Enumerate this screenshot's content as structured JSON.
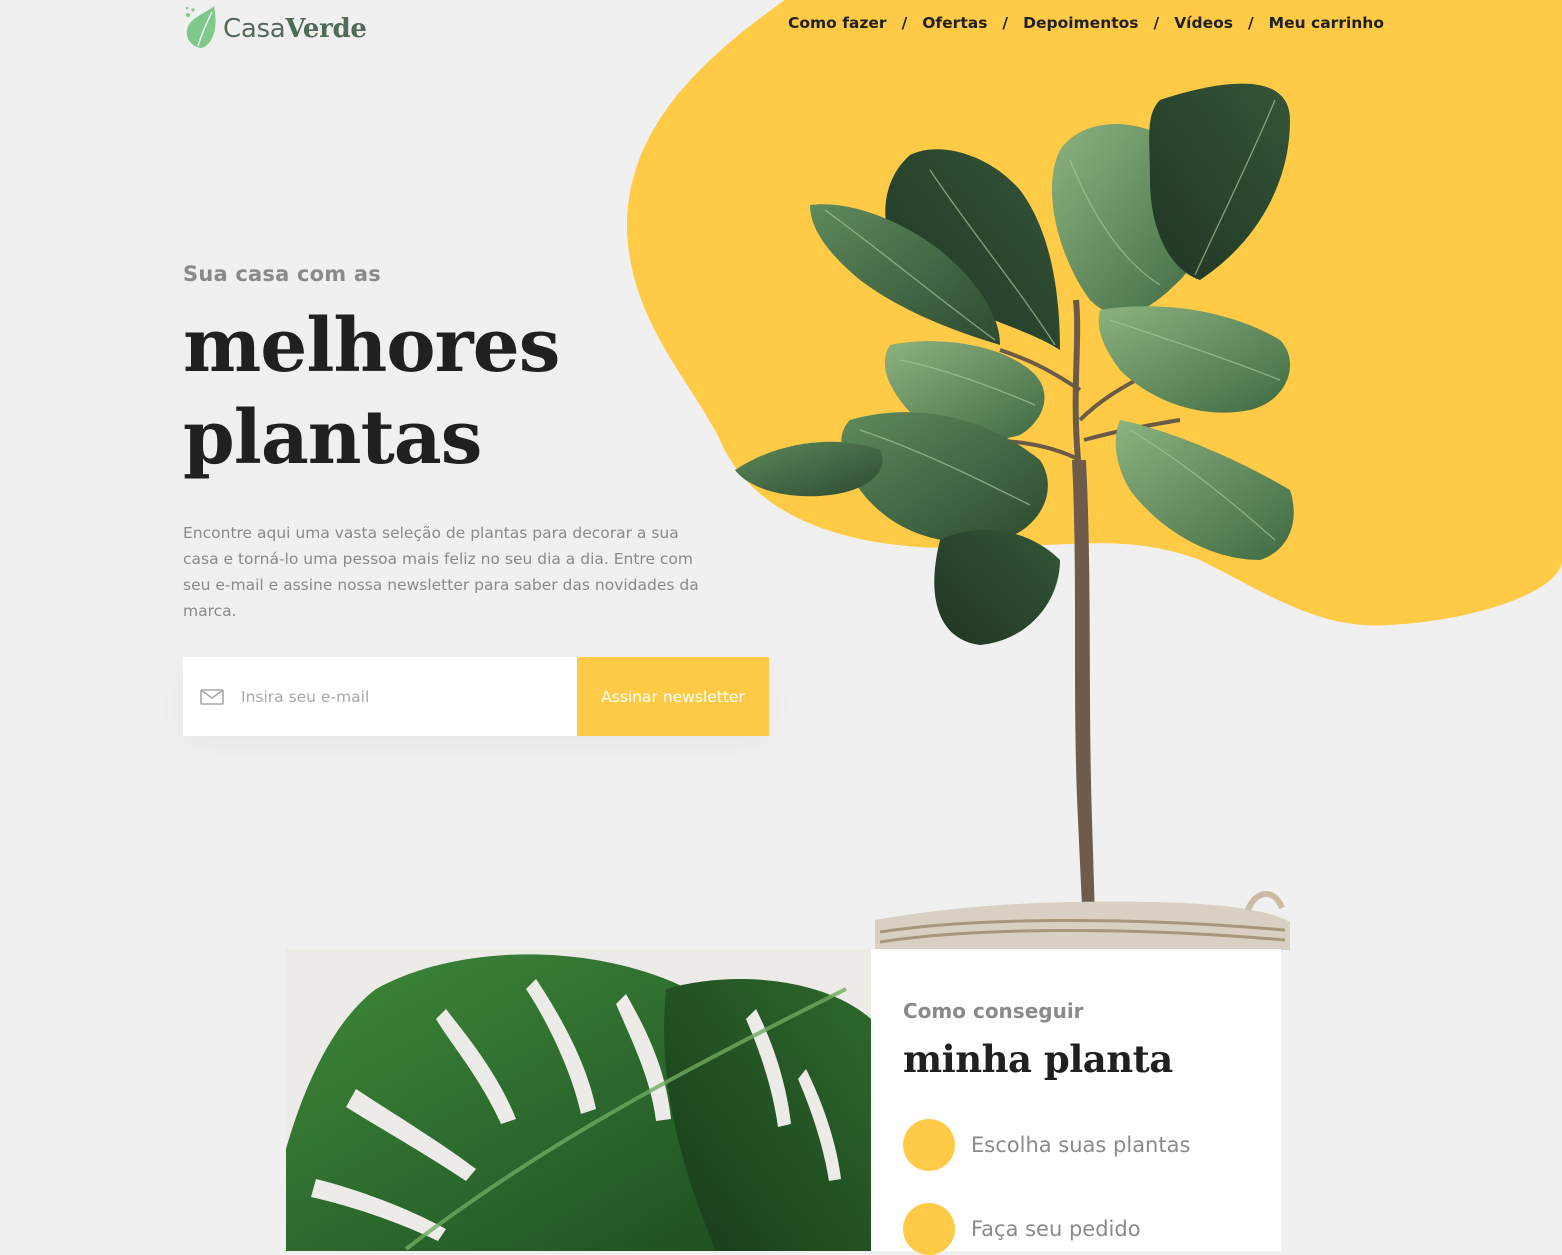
{
  "brand": {
    "name_light": "Casa",
    "name_bold": "Verde"
  },
  "nav": {
    "items": [
      {
        "label": "Como fazer"
      },
      {
        "label": "Ofertas"
      },
      {
        "label": "Depoimentos"
      },
      {
        "label": "Vídeos"
      },
      {
        "label": "Meu carrinho"
      }
    ],
    "separator": "/"
  },
  "hero": {
    "kicker": "Sua casa com as",
    "title_line1": "melhores",
    "title_line2": "plantas",
    "description": "Encontre aqui uma vasta seleção de plantas para decorar a sua casa e torná-lo uma pessoa mais feliz no seu dia a dia. Entre com seu e-mail e assine nossa newsletter para saber das novidades da marca."
  },
  "newsletter": {
    "email_placeholder": "Insira seu e-mail",
    "email_value": "",
    "button_label": "Assinar newsletter"
  },
  "how_to": {
    "kicker": "Como conseguir",
    "title": "minha planta",
    "steps": [
      {
        "label": "Escolha suas plantas"
      },
      {
        "label": "Faça seu pedido"
      }
    ]
  },
  "colors": {
    "accent": "#FFCB47",
    "background": "#F0F0F0",
    "text_dark": "#202020",
    "text_muted": "#8A8A8A",
    "leaf_green": "#3E6B45",
    "brand_green": "#4F6B55"
  },
  "icons": {
    "logo": "leaf-logo-icon",
    "email": "mail-icon",
    "step": "yellow-dot-icon"
  }
}
